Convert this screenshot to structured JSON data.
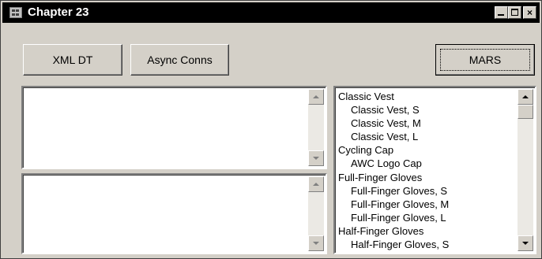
{
  "window": {
    "title": "Chapter 23",
    "controls": {
      "minimize": "",
      "maximize": "",
      "close": "×"
    }
  },
  "buttons": {
    "xml_dt": "XML DT",
    "async_conns": "Async Conns",
    "mars": "MARS"
  },
  "results_list": {
    "items": [
      {
        "text": "Classic Vest",
        "level": 0
      },
      {
        "text": "Classic Vest, S",
        "level": 1
      },
      {
        "text": "Classic Vest, M",
        "level": 1
      },
      {
        "text": "Classic Vest, L",
        "level": 1
      },
      {
        "text": "Cycling Cap",
        "level": 0
      },
      {
        "text": "AWC Logo Cap",
        "level": 1
      },
      {
        "text": "Full-Finger Gloves",
        "level": 0
      },
      {
        "text": "Full-Finger Gloves, S",
        "level": 1
      },
      {
        "text": "Full-Finger Gloves, M",
        "level": 1
      },
      {
        "text": "Full-Finger Gloves, L",
        "level": 1
      },
      {
        "text": "Half-Finger Gloves",
        "level": 0
      },
      {
        "text": "Half-Finger Gloves, S",
        "level": 1
      }
    ]
  }
}
